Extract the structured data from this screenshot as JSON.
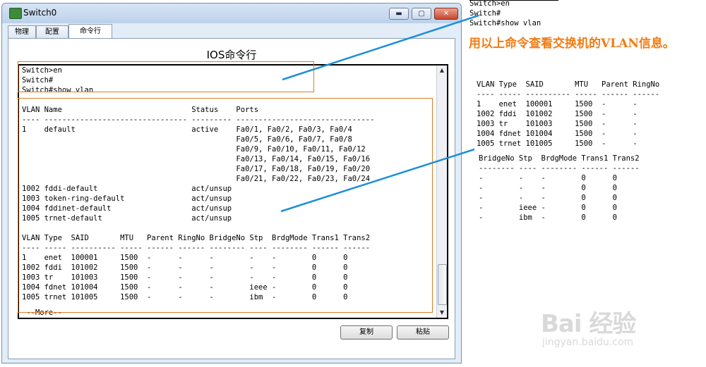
{
  "window": {
    "title": "Switch0",
    "tabs": [
      "物理",
      "配置",
      "命令行"
    ],
    "controls": {
      "minimize": "▬",
      "maximize": "▢",
      "close": "✕"
    }
  },
  "cli": {
    "title": "IOS命令行",
    "prompt_lines": "Switch>en\nSwitch#\nSwitch#show vlan",
    "vlan_table": "VLAN Name                             Status    Ports\n---- -------------------------------- --------- -------------------------------\n1    default                          active    Fa0/1, Fa0/2, Fa0/3, Fa0/4\n                                                Fa0/5, Fa0/6, Fa0/7, Fa0/8\n                                                Fa0/9, Fa0/10, Fa0/11, Fa0/12\n                                                Fa0/13, Fa0/14, Fa0/15, Fa0/16\n                                                Fa0/17, Fa0/18, Fa0/19, Fa0/20\n                                                Fa0/21, Fa0/22, Fa0/23, Fa0/24\n1002 fddi-default                     act/unsup\n1003 token-ring-default               act/unsup\n1004 fddinet-default                  act/unsup\n1005 trnet-default                    act/unsup",
    "type_table": "VLAN Type  SAID       MTU   Parent RingNo BridgeNo Stp  BrdgMode Trans1 Trans2\n---- ----- ---------- ----- ------ ------ -------- ---- -------- ------ ------\n1    enet  100001     1500  -      -      -        -    -        0      0\n1002 fddi  101002     1500  -      -      -        -    -        0      0\n1003 tr    101003     1500  -      -      -        -    -        0      0\n1004 fdnet 101004     1500  -      -      -        ieee -        0      0\n1005 trnet 101005     1500  -      -      -        ibm  -        0      0",
    "more": " --More--",
    "copy_button": "复制",
    "paste_button": "粘贴"
  },
  "annotation": {
    "commands": "Switch>en\nSwitch#\nSwitch#show vlan",
    "note": "用以上命令查看交换机的VLAN信息。",
    "table1": "VLAN Type  SAID       MTU   Parent RingNo\n---- ----- ---------- ----- ------ ------\n1    enet  100001     1500  -      -\n1002 fddi  101002     1500  -      -\n1003 tr    101003     1500  -      -\n1004 fdnet 101004     1500  -      -\n1005 trnet 101005     1500  -      -",
    "table2": "BridgeNo Stp  BrdgMode Trans1 Trans2\n-------- ---- -------- ------ ------\n-        -    -        0      0\n-        -    -        0      0\n-        -    -        0      0\n-        ieee -        0      0\n-        ibm  -        0      0"
  },
  "watermark": {
    "logo": "Bai 经验",
    "url": "jingyan.baidu.com"
  },
  "colors": {
    "highlight": "#e07b22",
    "connector": "#1f8fd6",
    "note_text": "#f07c14"
  }
}
